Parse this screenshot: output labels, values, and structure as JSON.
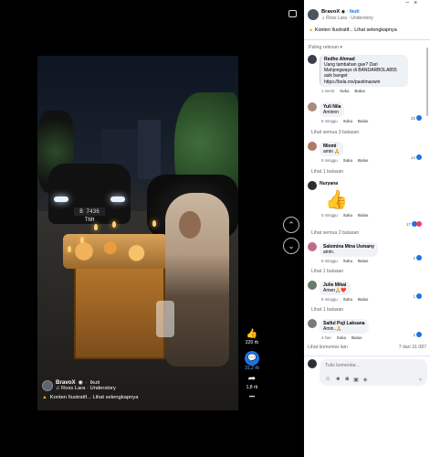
{
  "video": {
    "plate": "B 7436 TNH",
    "author": "BravoX",
    "follow": "Ikuti",
    "music": "♫ Ross Lara · Understory",
    "desc": "Konten Ilustratif... Lihat selengkapnya",
    "likes": "220 rb",
    "comments": "31,2 rb",
    "shares": "1,8 rb",
    "more": "•••"
  },
  "post": {
    "author": "BravoX",
    "follow": "· Ikuti",
    "music": "♫ Ross Lara · Understory",
    "desc": "Konten Ilustratif... Lihat selengkapnya",
    "sort": "Paling relevan ▾"
  },
  "comments": [
    {
      "name": "Redho Ahmad",
      "text": "Uang tambahan gue? Dari Mahjongways di BANDARBOLA855 asik banget https://bola.mx/pastimaxwin",
      "time": "1 menit",
      "like": "Suka",
      "reply": "Balas",
      "count": "",
      "color": "#3a3f4a"
    },
    {
      "name": "Yuli Nila",
      "text": "Aminnn",
      "time": "5 minggu",
      "like": "Suka",
      "reply": "Balas",
      "count": "28",
      "color": "#a88c7a"
    },
    {
      "name": "Miomi",
      "text": "amin 🙏",
      "time": "5 minggu",
      "like": "Suka",
      "reply": "Balas",
      "count": "14",
      "color": "#b07a68"
    },
    {
      "name": "Nuryana",
      "text": "👍",
      "time": "5 minggu",
      "like": "Suka",
      "reply": "Balas",
      "count": "17",
      "color": "#2d2d2d"
    },
    {
      "name": "Salomina Mina Usmany",
      "text": "amin.",
      "time": "5 minggu",
      "like": "Suka",
      "reply": "Balas",
      "count": "2",
      "color": "#c46b84"
    },
    {
      "name": "Julie Mikai",
      "text": "Amen🙏❤️",
      "time": "5 minggu",
      "like": "Suka",
      "reply": "Balas",
      "count": "1",
      "color": "#6b7b6a"
    },
    {
      "name": "Saiful Puji Laksana",
      "text": "Amin..🙏",
      "time": "4 hari",
      "like": "Suka",
      "reply": "Balas",
      "count": "2",
      "color": "#7a7a7a"
    }
  ],
  "more_links": {
    "yuli": "Lihat semua 3 balasan",
    "miomi": "Lihat 1 balasan",
    "nuryana": "Lihat semua 2 balasan",
    "salomina": "Lihat 1 balasan",
    "julie": "Lihat 1 balasan"
  },
  "footer": {
    "other": "Lihat komentar lain",
    "pagination": "7 dari 31.087",
    "placeholder": "Tulis komentar..."
  }
}
